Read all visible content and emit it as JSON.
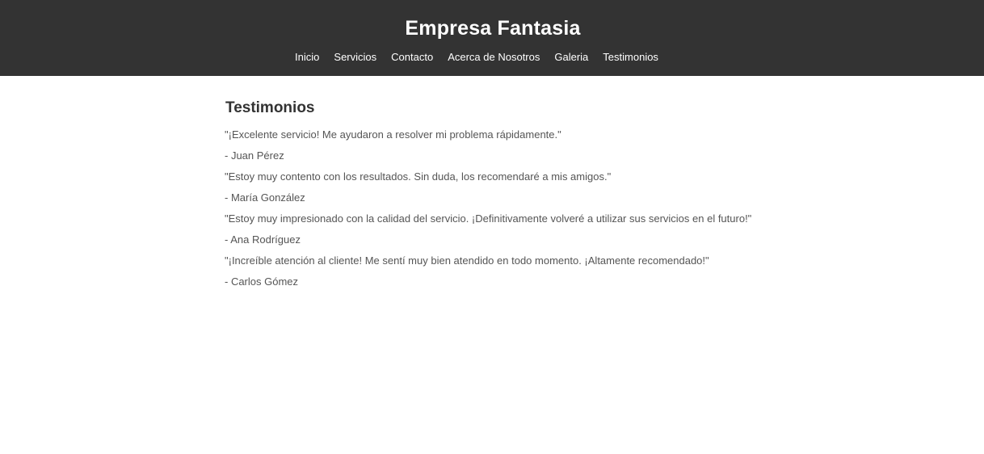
{
  "header": {
    "title": "Empresa Fantasia",
    "nav": [
      {
        "label": "Inicio"
      },
      {
        "label": "Servicios"
      },
      {
        "label": "Contacto"
      },
      {
        "label": "Acerca de Nosotros"
      },
      {
        "label": "Galeria"
      },
      {
        "label": "Testimonios"
      }
    ]
  },
  "main": {
    "section_title": "Testimonios",
    "testimonials": [
      {
        "quote": "\"¡Excelente servicio! Me ayudaron a resolver mi problema rápidamente.\"",
        "author": "- Juan Pérez"
      },
      {
        "quote": "\"Estoy muy contento con los resultados. Sin duda, los recomendaré a mis amigos.\"",
        "author": "- María González"
      },
      {
        "quote": "\"Estoy muy impresionado con la calidad del servicio. ¡Definitivamente volveré a utilizar sus servicios en el futuro!\"",
        "author": "- Ana Rodríguez"
      },
      {
        "quote": "\"¡Increíble atención al cliente! Me sentí muy bien atendido en todo momento. ¡Altamente recomendado!\"",
        "author": "- Carlos Gómez"
      }
    ]
  },
  "colors": {
    "header_bg": "#333333",
    "header_text": "#ffffff",
    "body_text": "#555555",
    "heading_text": "#333333"
  }
}
